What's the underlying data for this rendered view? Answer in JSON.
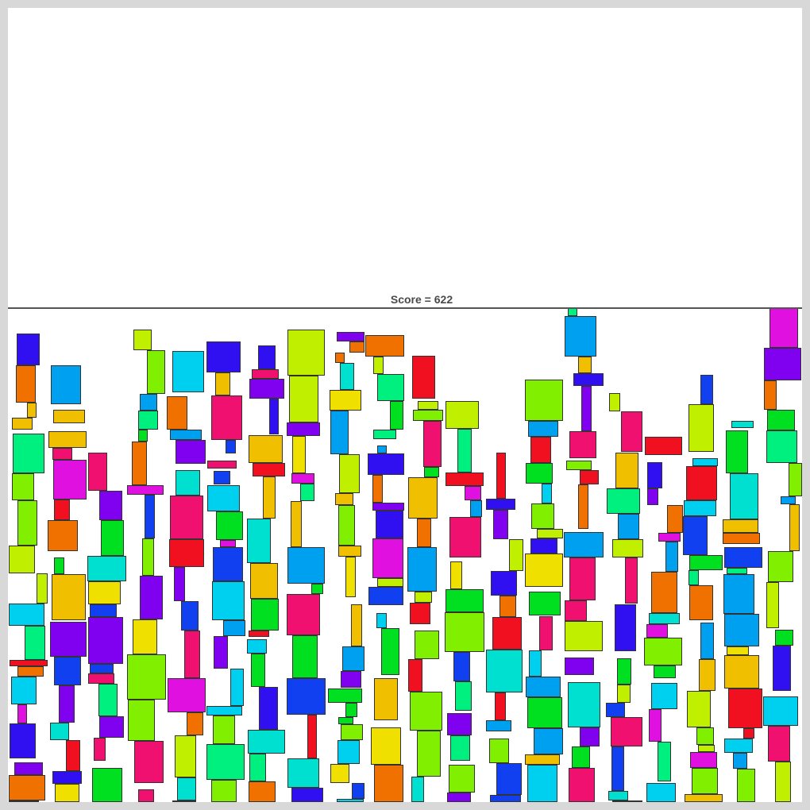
{
  "game": {
    "score_label": "Score =",
    "score": "622"
  },
  "colors": {
    "frame": "#d8d8d8",
    "board": "#ffffff",
    "limit_line": "#555555",
    "block_border": "#333333"
  }
}
